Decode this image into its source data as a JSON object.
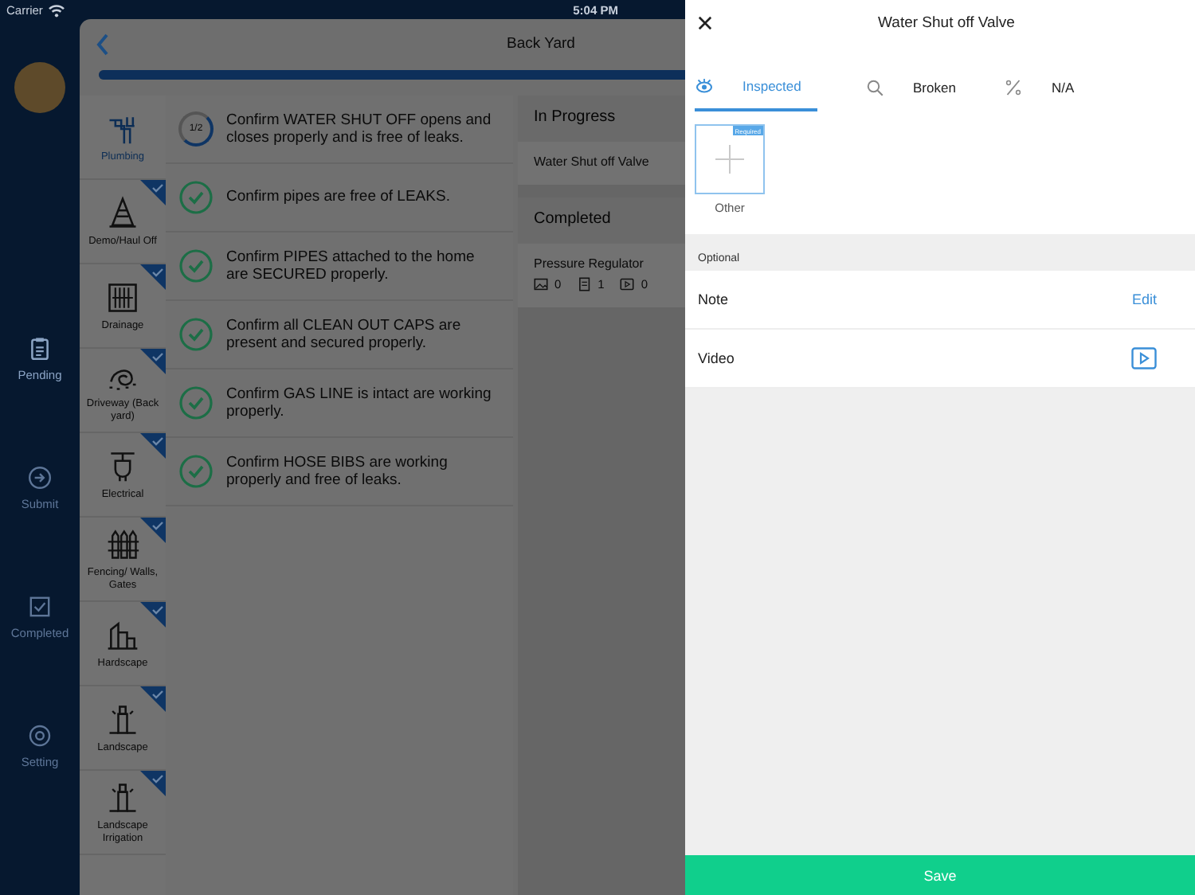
{
  "status_bar": {
    "carrier": "Carrier",
    "time": "5:04 PM"
  },
  "nav": [
    {
      "label": "Pending",
      "selected": true
    },
    {
      "label": "Submit",
      "selected": false
    },
    {
      "label": "Completed",
      "selected": false
    },
    {
      "label": "Setting",
      "selected": false
    }
  ],
  "header": {
    "title": "Back Yard",
    "progress": {
      "level": 1
    }
  },
  "categories": [
    {
      "label": "Plumbing",
      "selected": true,
      "checked": false
    },
    {
      "label": "Demo/Haul Off",
      "selected": false,
      "checked": true
    },
    {
      "label": "Drainage",
      "selected": false,
      "checked": true
    },
    {
      "label": "Driveway (Back yard)",
      "selected": false,
      "checked": true
    },
    {
      "label": "Electrical",
      "selected": false,
      "checked": true
    },
    {
      "label": "Fencing/ Walls, Gates",
      "selected": false,
      "checked": true
    },
    {
      "label": "Hardscape",
      "selected": false,
      "checked": true
    },
    {
      "label": "Landscape",
      "selected": false,
      "checked": true
    },
    {
      "label": "Landscape Irrigation",
      "selected": false,
      "checked": true
    }
  ],
  "checklist": [
    {
      "text": "Confirm WATER SHUT OFF opens and closes properly and is free of leaks.",
      "kind": "progress",
      "progress": "1/2"
    },
    {
      "text": "Confirm pipes are free of LEAKS.",
      "kind": "done"
    },
    {
      "text": "Confirm PIPES attached to the home are SECURED properly.",
      "kind": "done"
    },
    {
      "text": "Confirm  all CLEAN OUT CAPS are present and secured properly.",
      "kind": "done"
    },
    {
      "text": "Confirm GAS LINE is intact are working properly.",
      "kind": "done"
    },
    {
      "text": "Confirm HOSE BIBS are working properly and free of leaks.",
      "kind": "done"
    }
  ],
  "components": [
    {
      "title": "In Progress",
      "items": [
        {
          "name": "Water Shut off Valve"
        }
      ]
    },
    {
      "title": "Completed",
      "items": [
        {
          "name": "Pressure Regulator",
          "counts": [
            "0",
            "1",
            "0"
          ]
        }
      ]
    }
  ],
  "sheet": {
    "title": "Water Shut off Valve",
    "tabs": [
      {
        "label": "Inspected",
        "selected": true
      },
      {
        "label": "Broken",
        "selected": false
      },
      {
        "label": "N/A",
        "selected": false
      }
    ],
    "photos": [
      {
        "label": "Other",
        "badge": "Required"
      }
    ],
    "section_label": "Optional",
    "rows": [
      {
        "label": "Note",
        "kind": "link",
        "action": "Edit"
      },
      {
        "label": "Video",
        "kind": "video"
      }
    ],
    "save": "Save"
  }
}
